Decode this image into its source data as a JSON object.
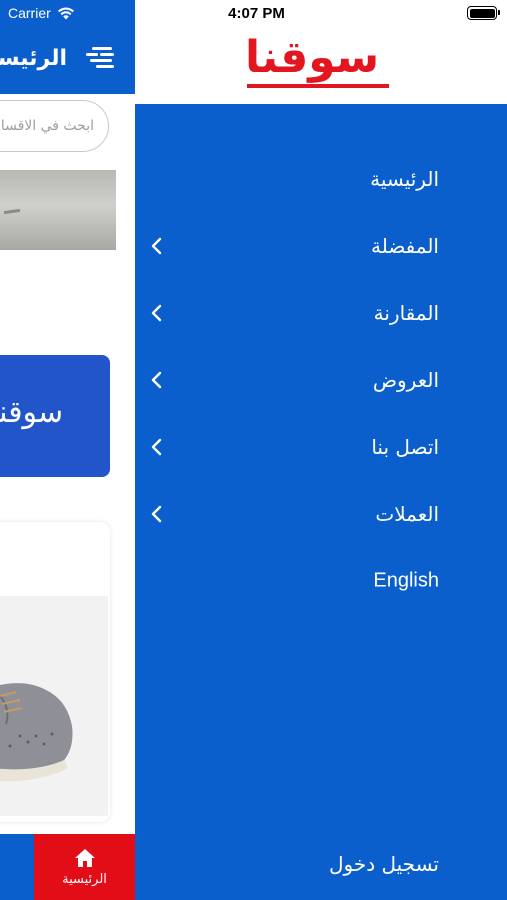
{
  "status_bar": {
    "carrier": "Carrier",
    "time": "4:07 PM"
  },
  "app_header": {
    "title": "الرئيسية"
  },
  "search": {
    "placeholder": "ابحث في الاقسام"
  },
  "promo_card": {
    "text": "سوقنا"
  },
  "bottom_nav": {
    "home_label": "الرئيسية"
  },
  "drawer": {
    "logo": "سوقنا",
    "menu_items": [
      {
        "label": "الرئيسية",
        "has_chevron": false
      },
      {
        "label": "المفضلة",
        "has_chevron": true
      },
      {
        "label": "المقارنة",
        "has_chevron": true
      },
      {
        "label": "العروض",
        "has_chevron": true
      },
      {
        "label": "اتصل بنا",
        "has_chevron": true
      },
      {
        "label": "العملات",
        "has_chevron": true
      },
      {
        "label": "English",
        "has_chevron": false
      }
    ],
    "login_label": "تسجيل دخول"
  },
  "colors": {
    "primary_blue": "#0a5fcc",
    "brand_red": "#e3161f",
    "home_tab_red": "#e30d18"
  },
  "icons": [
    "wifi-icon",
    "battery-icon",
    "menu-icon",
    "home-icon",
    "chevron-left-icon"
  ]
}
